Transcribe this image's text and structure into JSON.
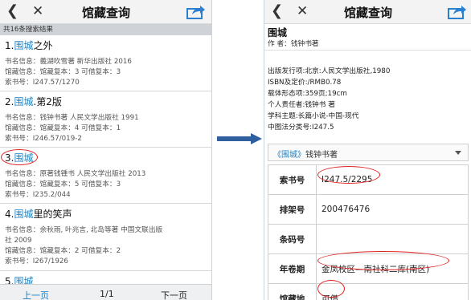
{
  "left": {
    "nav": {
      "back_icon": "back-chevron-icon",
      "close_icon": "close-icon",
      "title": "馆藏查询",
      "share_icon": "share-icon"
    },
    "result_count": "共16条搜索结果",
    "results": [
      {
        "title_pre": "1.",
        "title_hl": "围城",
        "title_post": "之外",
        "book_info": "书名信息：義湖吹雪著 新华出版社 2016",
        "holding_info": "馆藏信息：馆藏复本：3 可借复本：3",
        "call_number": "索书号：I247.57/1270"
      },
      {
        "title_pre": "2.",
        "title_hl": "围城",
        "title_post": ".第2版",
        "book_info": "书名信息：钱钟书著 人民文学出版社 1991",
        "holding_info": "馆藏信息：馆藏复本：4 可借复本：1",
        "call_number": "索书号：I246.57/019-2"
      },
      {
        "title_pre": "3.",
        "title_hl": "围城",
        "title_post": "",
        "book_info": "书名信息：原著钱锺书 人民文学出版社 2013",
        "holding_info": "馆藏信息：馆藏复本：5 可借复本：3",
        "call_number": "索书号：I235.2/044"
      },
      {
        "title_pre": "4.",
        "title_hl": "围城",
        "title_post": "里的笑声",
        "book_info": "书名信息：余秋雨, 叶兆言, 北岛等著 中国文联出版",
        "book_info_2": "社 2009",
        "holding_info": "馆藏信息：馆藏复本：2 可借复本：2",
        "call_number": "索书号：I267/1926"
      },
      {
        "title_pre": "5.",
        "title_hl": "围城",
        "title_post": ""
      }
    ],
    "pager": {
      "prev": "上一页",
      "page": "1/1",
      "next": "下一页"
    }
  },
  "right": {
    "nav": {
      "back_icon": "back-chevron-icon",
      "close_icon": "close-icon",
      "title": "馆藏查询",
      "share_icon": "share-icon"
    },
    "book_title": "围城",
    "author": "作 者：钱钟书著",
    "details": [
      "出版发行项:北京:人民文学出版社,1980",
      "ISBN及定价:/RMB0.78",
      "载体形态项:359页;19cm",
      "个人责任者:钱钟书 著",
      "学科主题:长篇小说-中国-现代",
      "中图法分类号:I247.5"
    ],
    "dropdown": {
      "hl": "《围城》",
      "rest": "钱钟书著"
    },
    "holding": [
      {
        "label": "索书号",
        "value": "I247.5/2295"
      },
      {
        "label": "排架号",
        "value": "200476476"
      },
      {
        "label": "条码号",
        "value": ""
      },
      {
        "label": "年卷期",
        "value": "金凤校区—南社科二库(南区)"
      },
      {
        "label": "馆藏地",
        "value": "可借"
      }
    ]
  },
  "colors": {
    "highlight": "#1b82c4",
    "annotation": "#e02020",
    "arrow": "#2f5f9e",
    "navbar": "#f3f3f3"
  }
}
